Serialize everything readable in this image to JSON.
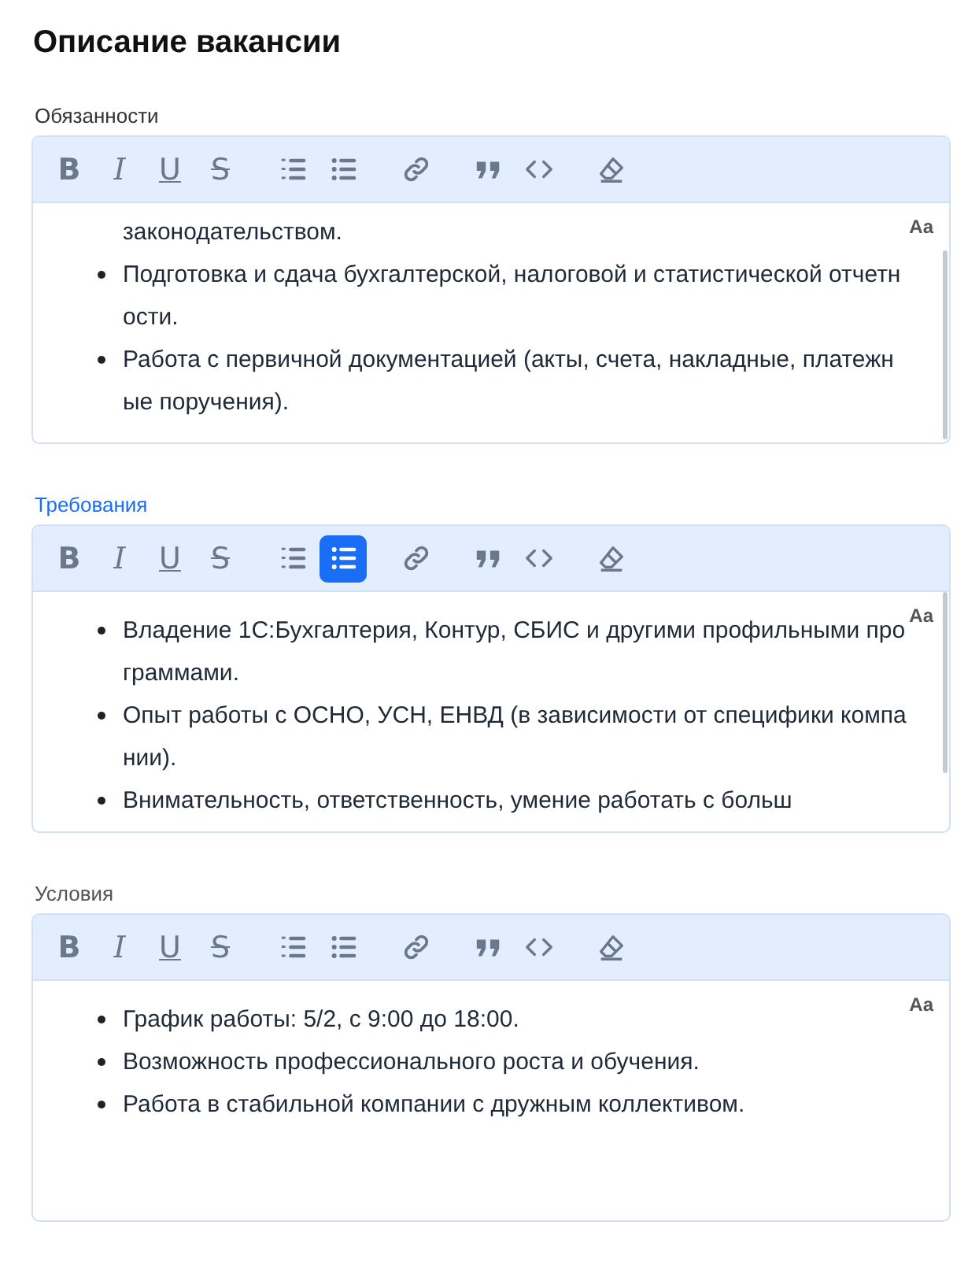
{
  "title": "Описание вакансии",
  "editors": [
    {
      "label": "Обязанности",
      "focused": false,
      "scrollable": true,
      "scrolled": true,
      "case_toggle": "Aa",
      "tools": [
        {
          "kind": "bold",
          "label": "B",
          "selected": false
        },
        {
          "kind": "italic",
          "label": "I",
          "selected": false
        },
        {
          "kind": "underline",
          "label": "U",
          "selected": false
        },
        {
          "kind": "strike",
          "label": "S",
          "selected": false
        },
        {
          "kind": "ordered-list",
          "selected": false
        },
        {
          "kind": "bullet-list",
          "selected": false
        },
        {
          "kind": "link",
          "selected": false
        },
        {
          "kind": "quote",
          "selected": false
        },
        {
          "kind": "code",
          "selected": false
        },
        {
          "kind": "clear-format",
          "selected": false
        }
      ],
      "items": [
        {
          "text": "законодательством.",
          "continuation": true
        },
        {
          "text": "Подготовка и сдача бухгалтерской, налоговой и статистической отчетности.",
          "continuation": false
        },
        {
          "text": "Работа с первичной документацией (акты, счета, накладные, платежные поручения).",
          "continuation": false
        }
      ]
    },
    {
      "label": "Требования",
      "focused": true,
      "scrollable": true,
      "scrolled": false,
      "case_toggle": "Aa",
      "tools": [
        {
          "kind": "bold",
          "label": "B",
          "selected": false
        },
        {
          "kind": "italic",
          "label": "I",
          "selected": false
        },
        {
          "kind": "underline",
          "label": "U",
          "selected": false
        },
        {
          "kind": "strike",
          "label": "S",
          "selected": false
        },
        {
          "kind": "ordered-list",
          "selected": false
        },
        {
          "kind": "bullet-list",
          "selected": true
        },
        {
          "kind": "link",
          "selected": false
        },
        {
          "kind": "quote",
          "selected": false
        },
        {
          "kind": "code",
          "selected": false
        },
        {
          "kind": "clear-format",
          "selected": false
        }
      ],
      "items": [
        {
          "text": "Владение 1С:Бухгалтерия, Контур, СБИС и другими профильными программами.",
          "continuation": false
        },
        {
          "text": "Опыт работы с ОСНО, УСН, ЕНВД (в зависимости от специфики компании).",
          "continuation": false
        },
        {
          "text": "Внимательность, ответственность, умение работать с больш",
          "continuation": false
        }
      ]
    },
    {
      "label": "Условия",
      "focused": false,
      "scrollable": false,
      "scrolled": false,
      "case_toggle": "Aa",
      "tools": [
        {
          "kind": "bold",
          "label": "B",
          "selected": false
        },
        {
          "kind": "italic",
          "label": "I",
          "selected": false
        },
        {
          "kind": "underline",
          "label": "U",
          "selected": false
        },
        {
          "kind": "strike",
          "label": "S",
          "selected": false
        },
        {
          "kind": "ordered-list",
          "selected": false
        },
        {
          "kind": "bullet-list",
          "selected": false
        },
        {
          "kind": "link",
          "selected": false
        },
        {
          "kind": "quote",
          "selected": false
        },
        {
          "kind": "code",
          "selected": false
        },
        {
          "kind": "clear-format",
          "selected": false
        }
      ],
      "items": [
        {
          "text": "График работы: 5/2, с 9:00 до 18:00.",
          "continuation": false
        },
        {
          "text": "Возможность профессионального роста и обучения.",
          "continuation": false
        },
        {
          "text": "Работа в стабильной компании с дружным коллективом.",
          "continuation": false
        }
      ]
    }
  ]
}
